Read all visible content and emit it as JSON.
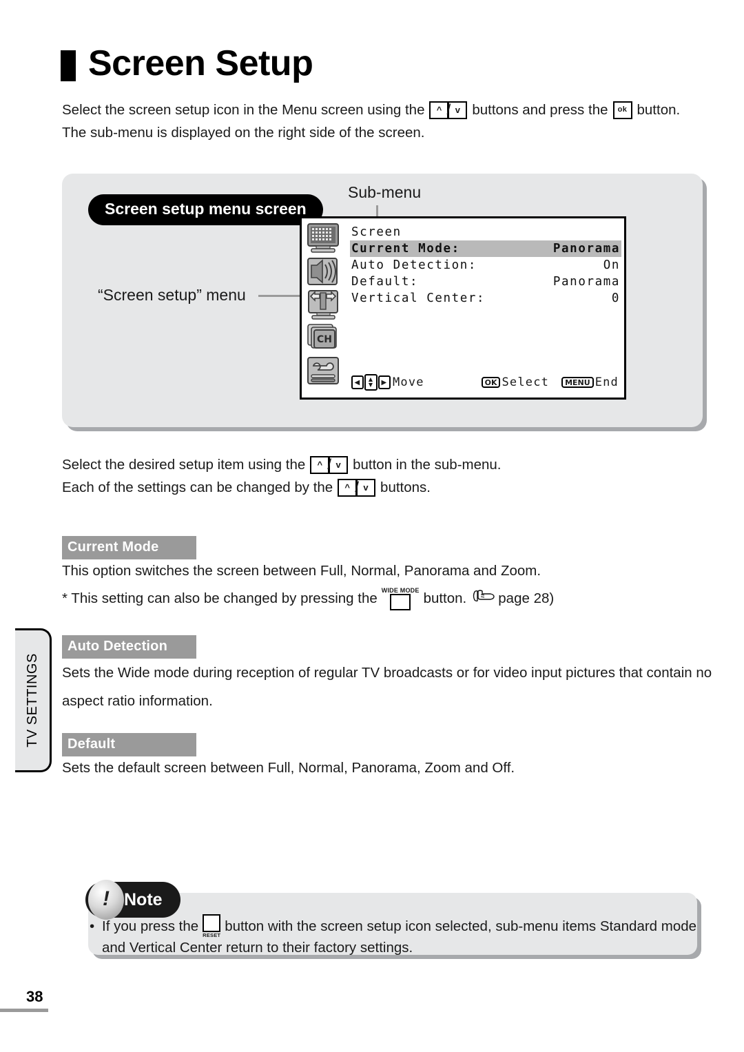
{
  "page": {
    "title": "Screen Setup",
    "number": "38",
    "side_tab": "TV SETTINGS"
  },
  "intro": {
    "line1_a": "Select the screen setup icon in the Menu screen using the",
    "key_up": "^",
    "key_sep": "/",
    "key_down": "v",
    "line1_b": "buttons and press the",
    "key_ok": "ok",
    "line1_c": "button.",
    "line2": "The sub-menu is displayed on the right side of the screen."
  },
  "diagram": {
    "callout_pill": "Screen setup menu screen",
    "submenu_label": "Sub-menu",
    "screen_setup_menu_label": "“Screen setup” menu",
    "osd": {
      "heading": "Screen",
      "rows": [
        {
          "label": "Current Mode:",
          "value": "Panorama",
          "selected": true
        },
        {
          "label": "Auto Detection:",
          "value": "On",
          "selected": false
        },
        {
          "label": "Default:",
          "value": "Panorama",
          "selected": false
        },
        {
          "label": "Vertical Center:",
          "value": "0",
          "selected": false
        }
      ],
      "icons": [
        "picture-settings-icon",
        "audio-settings-icon",
        "screen-setup-icon",
        "channel-settings-icon",
        "setup-tools-icon"
      ],
      "footer": {
        "move_label": "Move",
        "select_button": "OK",
        "select_label": "Select",
        "end_button": "MENU",
        "end_label": "End",
        "left_arrow": "◀",
        "right_arrow": "▶",
        "up_arrow": "▲",
        "down_arrow": "▼"
      }
    }
  },
  "instructions": {
    "line1_a": "Select the desired setup item using the",
    "line1_b": "button in the sub-menu.",
    "line2_a": "Each of the settings can be changed by the",
    "line2_b": "buttons.",
    "key_up": "^",
    "key_down": "v",
    "key_sep": "/"
  },
  "sections": [
    {
      "heading": "Current Mode",
      "body": "This option switches the screen between Full, Normal, Panorama and Zoom.",
      "note_a": "* This setting can also be changed by pressing the",
      "note_key_caption": "WIDE MODE",
      "note_b": "button.",
      "note_ref": "page 28)"
    },
    {
      "heading": "Auto Detection",
      "body_line1": "Sets the Wide mode during reception of regular TV broadcasts or for video input pictures that contain no",
      "body_line2": "aspect ratio information."
    },
    {
      "heading": "Default",
      "body": "Sets the default screen between Full, Normal, Panorama, Zoom and Off."
    }
  ],
  "note": {
    "title": "Note",
    "bullet": "•",
    "line1_a": "If you press the",
    "key_caption": "RESET",
    "line1_b": "button with the screen setup icon selected, sub-menu items Standard mode",
    "line2": "and Vertical Center return to their factory settings."
  },
  "colors": {
    "panel_bg": "#e6e7e8",
    "panel_shadow": "#a7a9ac",
    "section_head_bg": "#9a9a9a",
    "osd_selected_bg": "#b9b9b9",
    "pill_bg": "#000000"
  }
}
